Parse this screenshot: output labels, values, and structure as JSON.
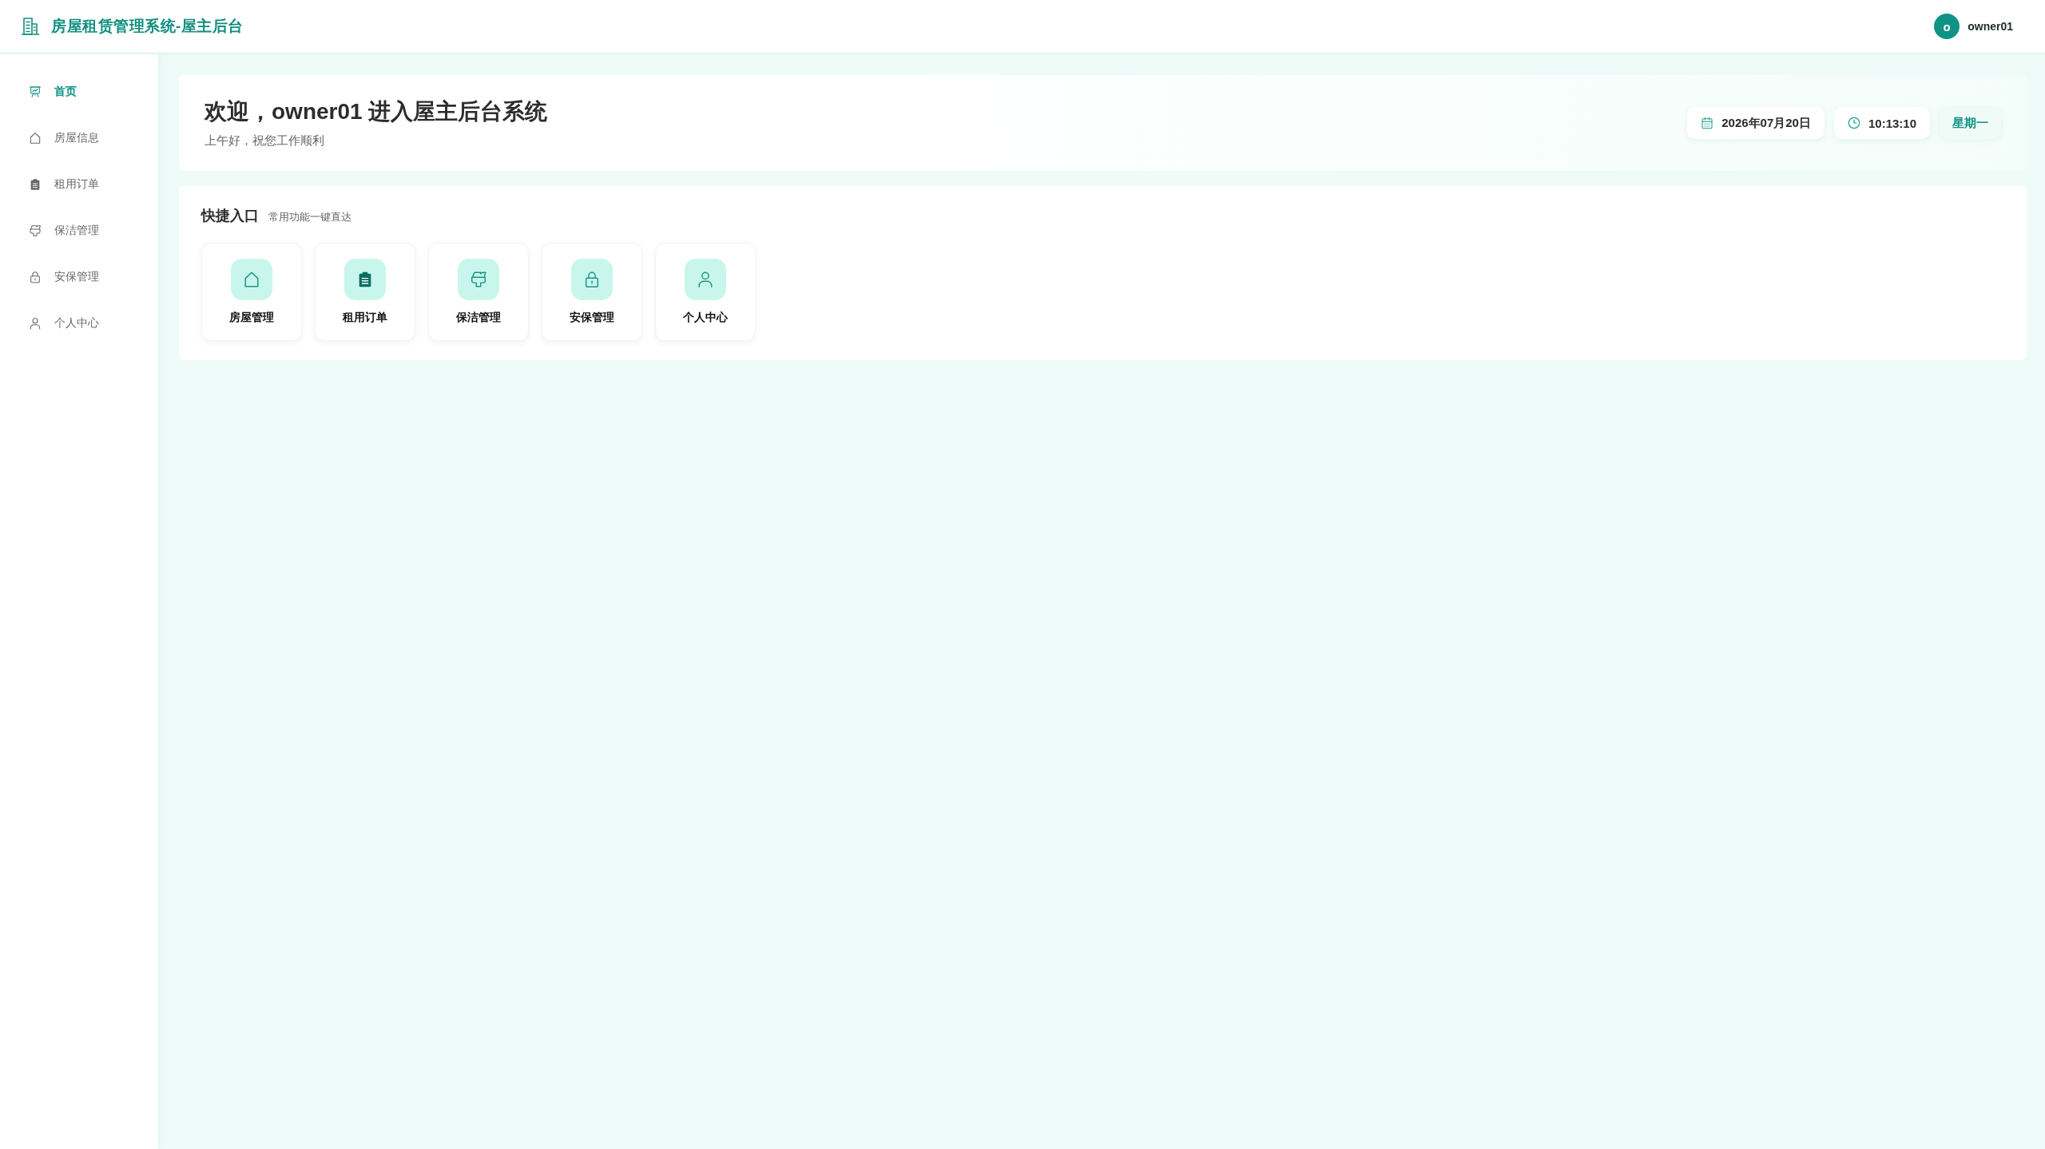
{
  "header": {
    "title": "房屋租赁管理系统-屋主后台",
    "user": {
      "avatar": "o",
      "name": "owner01"
    }
  },
  "sidebar": {
    "items": [
      {
        "label": "首页",
        "kind": "board",
        "selected": true
      },
      {
        "label": "房屋信息",
        "kind": "house",
        "selected": false
      },
      {
        "label": "租用订单",
        "kind": "clipboard",
        "selected": false
      },
      {
        "label": "保洁管理",
        "kind": "brush",
        "selected": false
      },
      {
        "label": "安保管理",
        "kind": "lock",
        "selected": false
      },
      {
        "label": "个人中心",
        "kind": "user",
        "selected": false
      }
    ]
  },
  "welcome": {
    "title": "欢迎，owner01 进入屋主后台系统",
    "subtitle": "上午好，祝您工作顺利",
    "date": "2026年07月20日",
    "time": "10:13:10",
    "weekday": "星期一"
  },
  "quick_entry": {
    "title": "快捷入口",
    "subtitle": "常用功能一键直达",
    "items": [
      {
        "label": "房屋管理",
        "kind": "house"
      },
      {
        "label": "租用订单",
        "kind": "clipboard"
      },
      {
        "label": "保洁管理",
        "kind": "brush"
      },
      {
        "label": "安保管理",
        "kind": "lock"
      },
      {
        "label": "个人中心",
        "kind": "user"
      }
    ]
  }
}
